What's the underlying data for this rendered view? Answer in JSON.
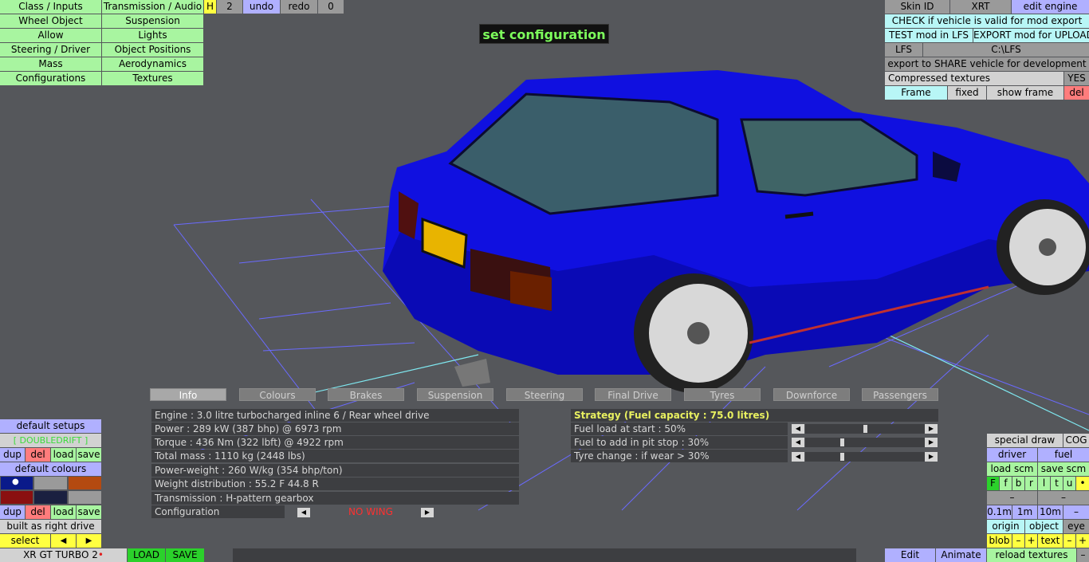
{
  "topleft": {
    "col1": [
      "Class / Inputs",
      "Wheel Object",
      "Allow",
      "Steering / Driver",
      "Mass",
      "Configurations"
    ],
    "col2": [
      "Transmission / Audio",
      "Suspension",
      "Lights",
      "Object Positions",
      "Aerodynamics",
      "Textures"
    ],
    "h": "H",
    "num": "2",
    "undo": "undo",
    "redo": "redo",
    "zero": "0"
  },
  "center_title": "set configuration",
  "topright": {
    "skin_id": "Skin ID",
    "xrt": "XRT",
    "edit_engine": "edit engine",
    "check": "CHECK if vehicle is valid for mod export",
    "test": "TEST mod in LFS",
    "export": "EXPORT mod for UPLOAD",
    "lfs": "LFS",
    "path": "C:\\LFS",
    "share": "export to SHARE vehicle for development",
    "compressed": "Compressed textures",
    "yes": "YES",
    "frame": "Frame",
    "fixed": "fixed",
    "show_frame": "show frame",
    "del": "del"
  },
  "tabs": [
    "Info",
    "Colours",
    "Brakes",
    "Suspension",
    "Steering",
    "Final Drive",
    "Tyres",
    "Downforce",
    "Passengers"
  ],
  "info_rows": [
    "Engine : 3.0 litre turbocharged inline 6 / Rear wheel drive",
    "Power : 289 kW (387 bhp) @ 6973 rpm",
    "Torque : 436 Nm (322 lbft) @ 4922 rpm",
    "Total mass : 1110 kg (2448 lbs)",
    "Power-weight : 260 W/kg (354 bhp/ton)",
    "Weight distribution : 55.2 F  44.8 R",
    "Transmission : H-pattern gearbox"
  ],
  "configuration": {
    "label": "Configuration",
    "value": "NO WING"
  },
  "strategy": {
    "title": "Strategy (Fuel capacity : 75.0 litres)",
    "rows": [
      {
        "label": "Fuel load at start : 50%",
        "level": 0.5
      },
      {
        "label": "Fuel to add in pit stop : 30%",
        "level": 0.3
      },
      {
        "label": "Tyre change : if wear > 30%",
        "level": 0.3
      }
    ]
  },
  "bottomleft": {
    "default_setups": "default setups",
    "setup_name": "[ DOUBLEDRIFT ]",
    "dup": "dup",
    "del": "del",
    "load": "load",
    "save": "save",
    "default_colours": "default colours",
    "built_as": "built as right drive",
    "select": "select",
    "left": "◀",
    "right": "▶",
    "car_name": "XR GT TURBO 2",
    "load_big": "LOAD",
    "save_big": "SAVE"
  },
  "bottomright": {
    "special_draw": "special draw",
    "cog": "COG",
    "driver": "driver",
    "fuel": "fuel",
    "load_scm": "load scm",
    "save_scm": "save scm",
    "letters": [
      "F",
      "f",
      "b",
      "r",
      "l",
      "t",
      "u"
    ],
    "minus": "–",
    "d01": "0.1m",
    "d1": "1m",
    "d10": "10m",
    "origin": "origin",
    "object": "object",
    "eye": "eye",
    "blob": "blob",
    "text": "text",
    "plus": "+",
    "edit": "Edit",
    "animate": "Animate",
    "reload": "reload textures"
  },
  "colors": {
    "car_body": "#1010e0",
    "green_btn": "#a8f5a0",
    "cyan_btn": "#b8f6f6",
    "violet_btn": "#b0b0ff",
    "yellow_btn": "#ffff40",
    "red_btn": "#ff7c7c",
    "grid_line": "#6a6aff",
    "axis_line": "#7fe8f0",
    "title_text": "#7dff5c",
    "config_value": "#ff3030",
    "strategy_title": "#e8f060"
  }
}
